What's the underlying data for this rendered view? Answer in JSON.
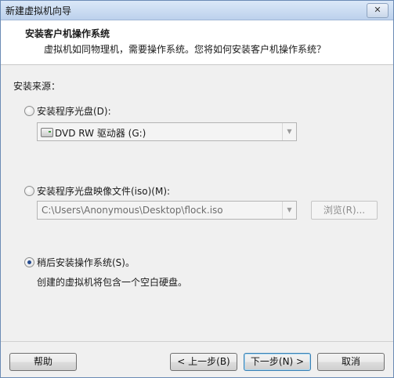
{
  "window": {
    "title": "新建虚拟机向导",
    "close_label": "✕"
  },
  "header": {
    "title": "安装客户机操作系统",
    "subtitle": "虚拟机如同物理机，需要操作系统。您将如何安装客户机操作系统？"
  },
  "source": {
    "label": "安装来源：",
    "disc": {
      "label": "安装程序光盘(D):",
      "selected": false,
      "drive_value": "DVD RW 驱动器 (G:)"
    },
    "iso": {
      "label": "安装程序光盘映像文件(iso)(M):",
      "selected": false,
      "path_value": "C:\\Users\\Anonymous\\Desktop\\flock.iso",
      "browse_label": "浏览(R)..."
    },
    "later": {
      "label": "稍后安装操作系统(S)。",
      "selected": true,
      "description": "创建的虚拟机将包含一个空白硬盘。"
    }
  },
  "footer": {
    "help_label": "帮助",
    "back_label": "< 上一步(B)",
    "next_label": "下一步(N) >",
    "cancel_label": "取消"
  },
  "colors": {
    "title_bar": "#bcd1ec",
    "header_bg": "#ffffff",
    "dialog_bg": "#f0f0f0",
    "default_button_border": "#3c7fb1"
  }
}
